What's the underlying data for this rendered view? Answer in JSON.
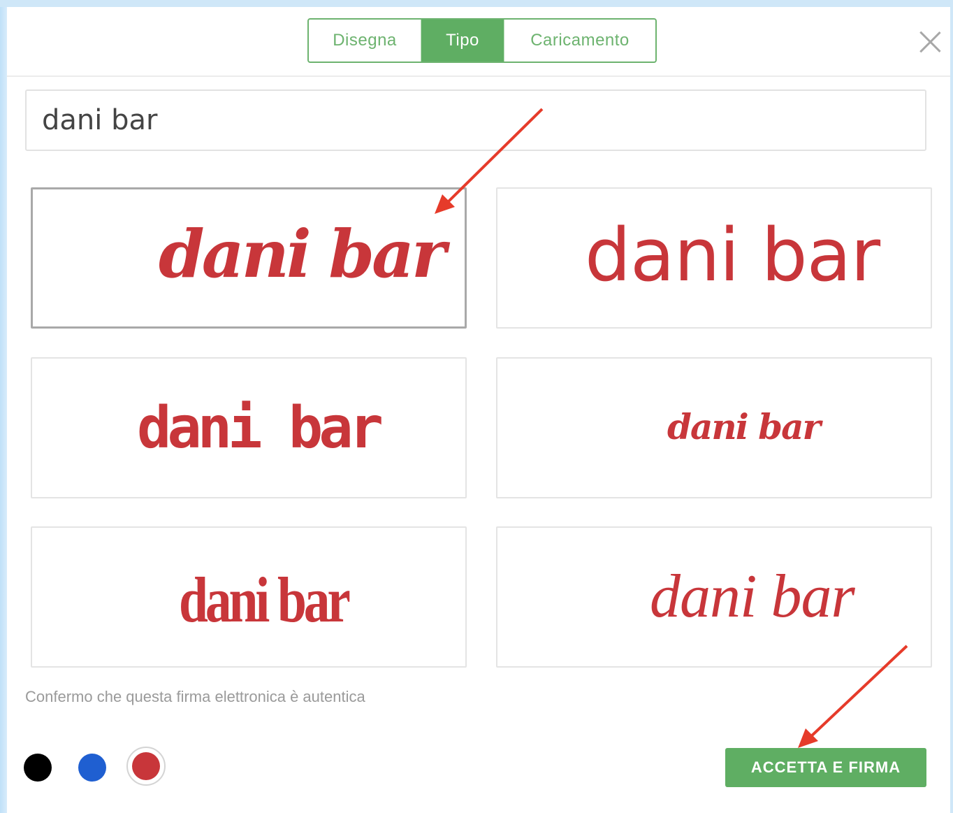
{
  "tabs": [
    {
      "label": "Disegna",
      "active": false
    },
    {
      "label": "Tipo",
      "active": true
    },
    {
      "label": "Caricamento",
      "active": false
    }
  ],
  "icons": {
    "close": "close-icon"
  },
  "name_input": {
    "value": "dani bar"
  },
  "signatures": [
    {
      "text": "dani bar",
      "selected": true
    },
    {
      "text": "dani bar",
      "selected": false
    },
    {
      "text": "dani bar",
      "selected": false
    },
    {
      "text": "dani bar",
      "selected": false
    },
    {
      "text": "dani bar",
      "selected": false
    },
    {
      "text": "dani bar",
      "selected": false
    }
  ],
  "confirm_text": "Confermo che questa firma elettronica è autentica",
  "colors": [
    {
      "name": "black",
      "hex": "#000000",
      "selected": false
    },
    {
      "name": "blue",
      "hex": "#1f5fd1",
      "selected": false
    },
    {
      "name": "red",
      "hex": "#c8363a",
      "selected": true
    }
  ],
  "accept_button": "ACCETTA E FIRMA",
  "theme": {
    "accent": "#5fae63",
    "signature_color": "#c8363a",
    "annotation_arrow": "#e63b2a"
  }
}
